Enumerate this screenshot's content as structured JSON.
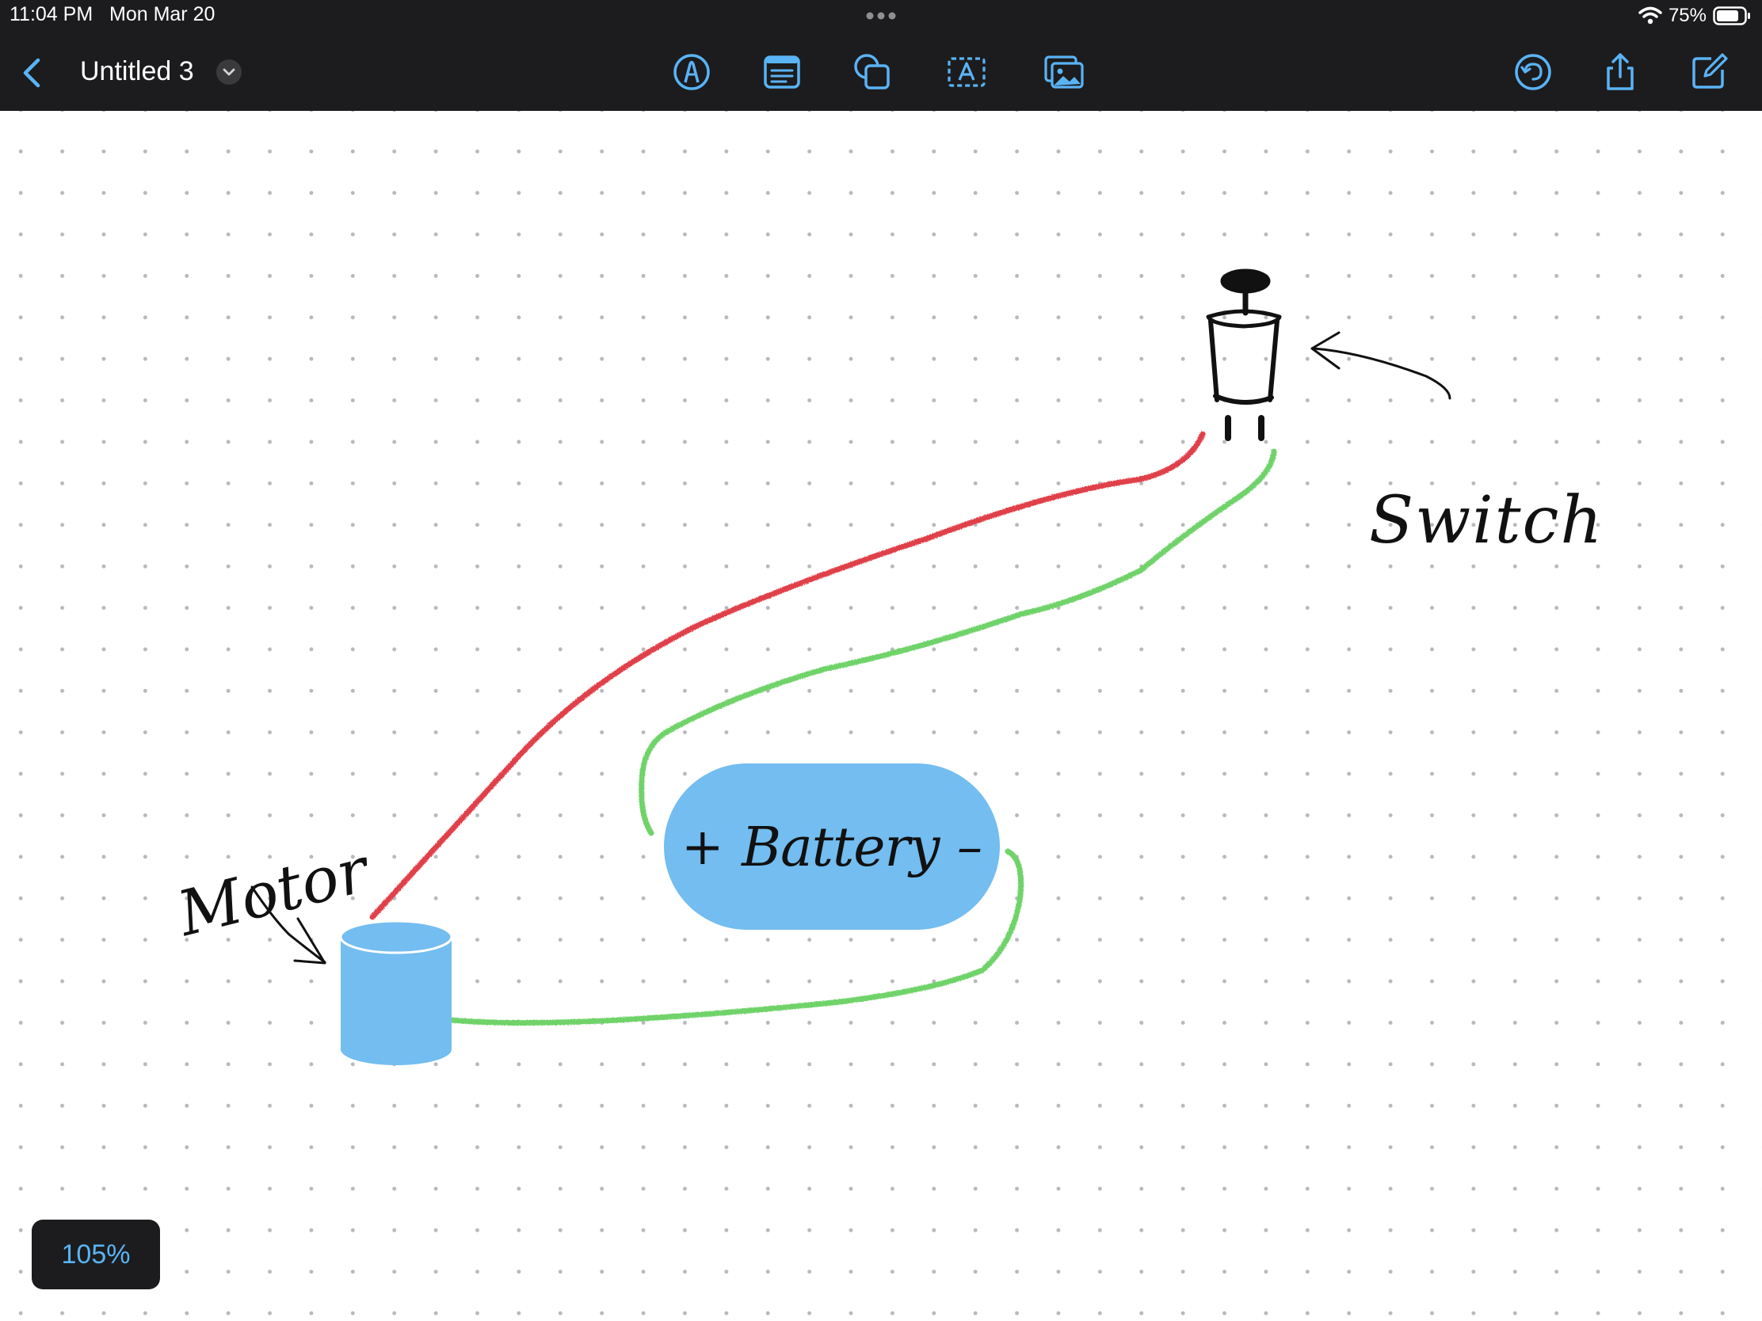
{
  "status_bar": {
    "time": "11:04 PM",
    "date": "Mon Mar 20",
    "battery_percent": "75%"
  },
  "toolbar": {
    "document_title": "Untitled 3",
    "tools": [
      "pen-tool",
      "sticky-note",
      "shapes",
      "text-box",
      "photos"
    ],
    "right_actions": [
      "undo",
      "share",
      "new-board"
    ]
  },
  "board": {
    "labels": {
      "motor": "Motor",
      "switch": "Switch",
      "battery_plus": "+",
      "battery_word": "Battery",
      "battery_minus": "–"
    },
    "colors": {
      "shape_fill": "#73bdf0",
      "wire_red": "#e0404a",
      "wire_green": "#6fd36a",
      "ink": "#111111",
      "accent": "#5ab3f5"
    }
  },
  "zoom": {
    "level": "105%"
  }
}
